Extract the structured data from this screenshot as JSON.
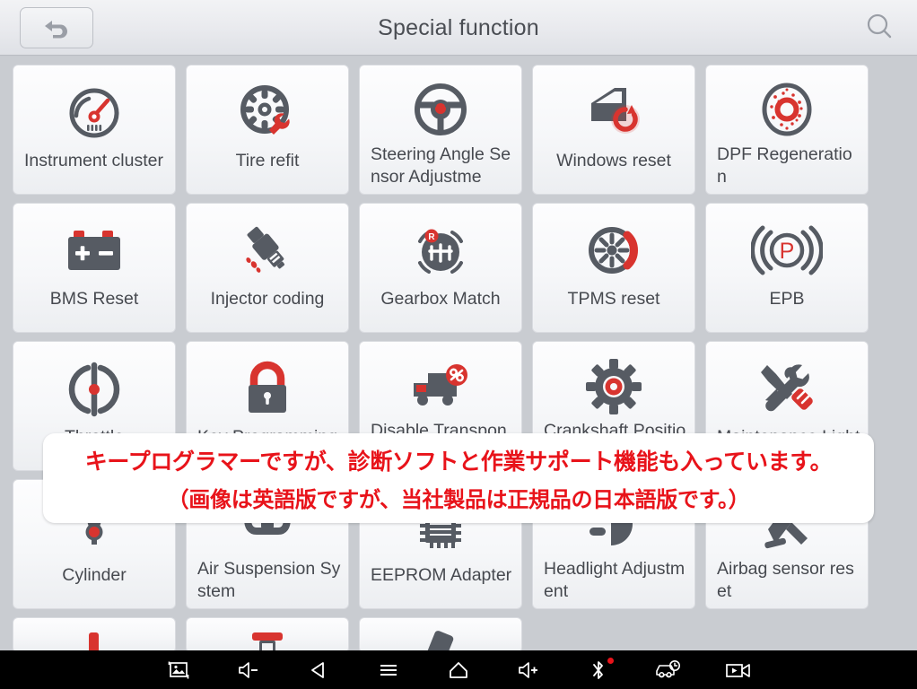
{
  "header": {
    "title": "Special function",
    "back_icon": "back-arrow-icon",
    "search_icon": "search-icon"
  },
  "colors": {
    "accent_red": "#d8342f",
    "icon_gray": "#565b63",
    "background": "#c9ccd1",
    "tile": "#f7f8fa",
    "banner_text": "#e8131a",
    "navbar": "#000000"
  },
  "grid": {
    "tiles": [
      {
        "label": "Instrument cluster",
        "icon": "gauge-icon",
        "wrap": true
      },
      {
        "label": "Tire refit",
        "icon": "tire-wrench-icon",
        "wrap": false
      },
      {
        "label": "Steering Angle Sensor Adjustme",
        "icon": "steering-wheel-icon",
        "wrap": true
      },
      {
        "label": "Windows reset",
        "icon": "car-door-reset-icon",
        "wrap": false
      },
      {
        "label": "DPF Regeneration",
        "icon": "dpf-filter-icon",
        "wrap": true
      },
      {
        "label": "BMS Reset",
        "icon": "battery-icon",
        "wrap": false
      },
      {
        "label": "Injector coding",
        "icon": "injector-icon",
        "wrap": false
      },
      {
        "label": "Gearbox Match",
        "icon": "gearbox-icon",
        "wrap": false
      },
      {
        "label": "TPMS reset",
        "icon": "tpms-tire-icon",
        "wrap": false
      },
      {
        "label": "EPB",
        "icon": "epb-parking-brake-icon",
        "wrap": false
      },
      {
        "label": "Throttle",
        "icon": "throttle-icon",
        "wrap": false
      },
      {
        "label": "Key Programming",
        "icon": "lock-key-icon",
        "wrap": true
      },
      {
        "label": "Disable Transponder",
        "icon": "truck-disable-icon",
        "wrap": true
      },
      {
        "label": "Crankshaft Position",
        "icon": "gear-crankshaft-icon",
        "wrap": true
      },
      {
        "label": "Maintenance Light",
        "icon": "wrench-screwdriver-icon",
        "wrap": true
      },
      {
        "label": "Cylinder",
        "icon": "cylinder-icon",
        "wrap": false
      },
      {
        "label": "Air Suspension System",
        "icon": "air-suspension-icon",
        "wrap": true
      },
      {
        "label": "EEPROM Adapter",
        "icon": "eeprom-chip-icon",
        "wrap": true
      },
      {
        "label": "Headlight Adjustment",
        "icon": "headlight-icon",
        "wrap": true
      },
      {
        "label": "Airbag sensor reset",
        "icon": "airbag-seat-icon",
        "wrap": true
      }
    ],
    "clipped_row": [
      {
        "label": "",
        "icon": "partial-red-icon"
      },
      {
        "label": "",
        "icon": "partial-red-tool-icon"
      },
      {
        "label": "",
        "icon": "partial-gray-icon"
      }
    ]
  },
  "banner": {
    "line1": "キープログラマーですが、診断ソフトと作業サポート機能も入っています。",
    "line2": "（画像は英語版ですが、当社製品は正規品の日本語版です。）"
  },
  "navbar": {
    "items": [
      {
        "icon": "screenshot-icon"
      },
      {
        "icon": "volume-down-icon"
      },
      {
        "icon": "back-triangle-icon"
      },
      {
        "icon": "menu-icon"
      },
      {
        "icon": "home-icon"
      },
      {
        "icon": "volume-up-icon"
      },
      {
        "icon": "bluetooth-icon",
        "badge": true
      },
      {
        "icon": "car-clock-icon"
      },
      {
        "icon": "video-record-icon"
      }
    ]
  }
}
